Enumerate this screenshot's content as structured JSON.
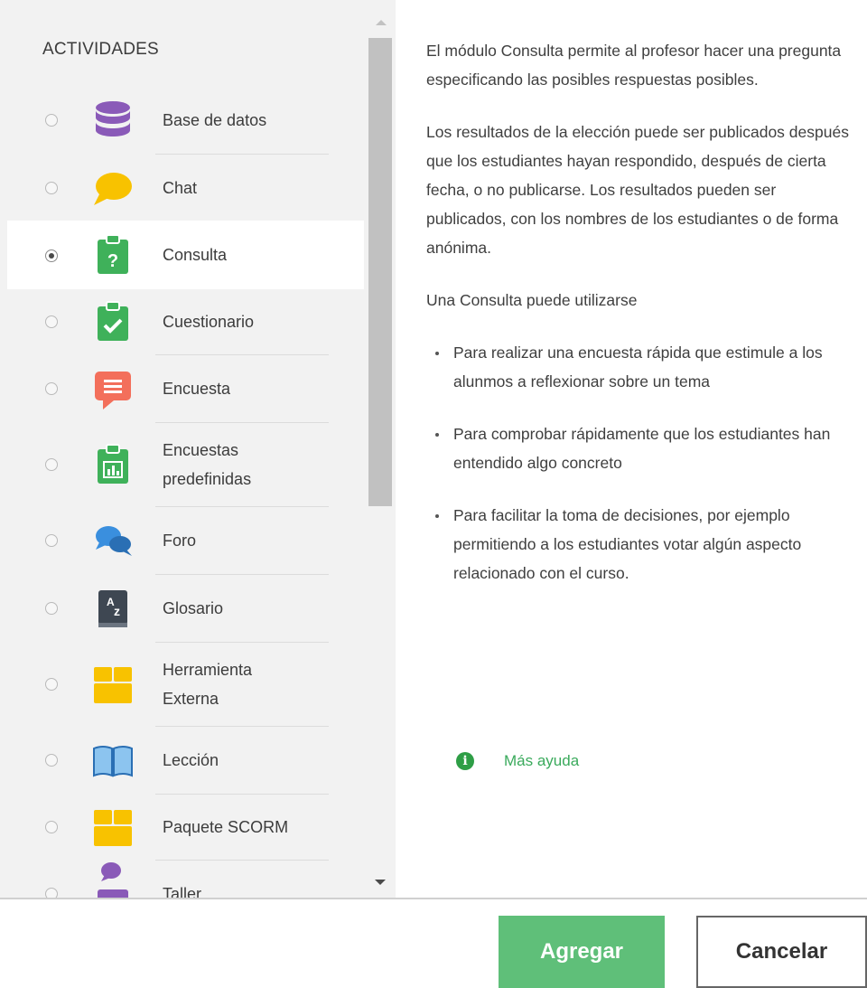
{
  "sidebar": {
    "title": "ACTIVIDADES",
    "items": [
      {
        "label": "Base de datos",
        "icon": "database-icon",
        "selected": false
      },
      {
        "label": "Chat",
        "icon": "chat-bubble-icon",
        "selected": false
      },
      {
        "label": "Consulta",
        "icon": "clipboard-question-icon",
        "selected": true
      },
      {
        "label": "Cuestionario",
        "icon": "clipboard-check-icon",
        "selected": false
      },
      {
        "label": "Encuesta",
        "icon": "survey-speech-icon",
        "selected": false
      },
      {
        "label": "Encuestas",
        "label2": "predefinidas",
        "icon": "clipboard-chart-icon",
        "selected": false
      },
      {
        "label": "Foro",
        "icon": "forum-bubbles-icon",
        "selected": false
      },
      {
        "label": "Glosario",
        "icon": "glossary-az-icon",
        "selected": false
      },
      {
        "label": "Herramienta",
        "label2": "Externa",
        "icon": "puzzle-box-icon",
        "selected": false
      },
      {
        "label": "Lección",
        "icon": "book-open-icon",
        "selected": false
      },
      {
        "label": "Paquete SCORM",
        "icon": "package-box-icon",
        "selected": false
      },
      {
        "label": "Taller",
        "icon": "workshop-icon",
        "selected": false
      }
    ]
  },
  "help": {
    "paragraph1": "El módulo Consulta permite al profesor hacer una pregunta especificando las posibles respuestas posibles.",
    "paragraph2": "Los resultados de la elección puede ser publicados después que los estudiantes hayan respondido, después de cierta fecha, o no publicarse. Los resultados pueden ser publicados, con los nombres de los estudiantes o de forma anónima.",
    "paragraph3": "Una Consulta puede utilizarse",
    "bullets": [
      "Para realizar una encuesta rápida que estimule a los alunmos a reflexionar sobre un tema",
      "Para comprobar rápidamente que los estudiantes han entendido algo concreto",
      "Para facilitar la toma de decisiones, por ejemplo permitiendo a los estudiantes votar algún aspecto relacionado con el curso."
    ],
    "more_help": "Más ayuda",
    "more_help_icon": "info-circle-icon"
  },
  "footer": {
    "add_label": "Agregar",
    "cancel_label": "Cancelar"
  },
  "colors": {
    "accent": "#5fbf79",
    "link": "#3aaa5c"
  }
}
